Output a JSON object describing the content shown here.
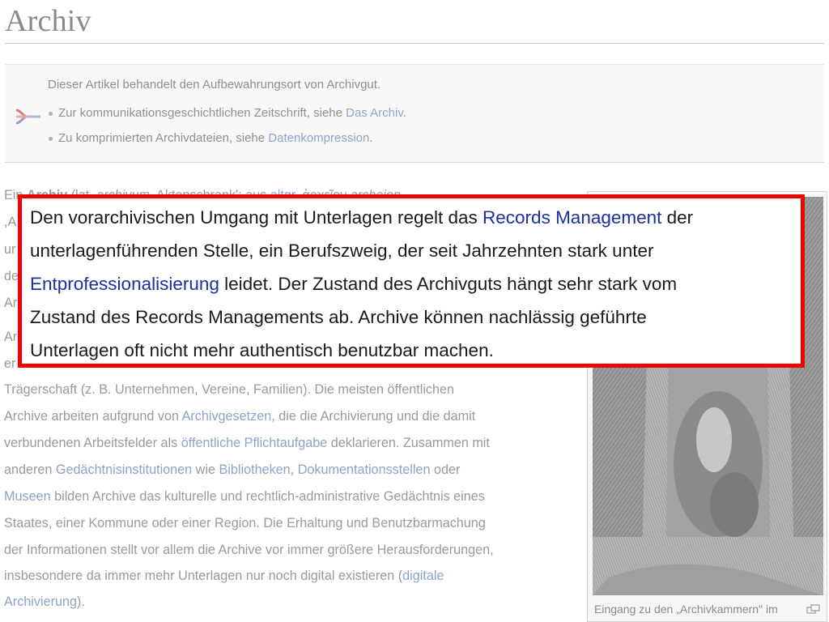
{
  "article": {
    "title": "Archiv"
  },
  "hatnote": {
    "intro": "Dieser Artikel behandelt den Aufbewahrungsort von Archivgut.",
    "items": [
      {
        "prefix": "Zur kommunikationsgeschichtlichen Zeitschrift, siehe ",
        "link": "Das Archiv",
        "suffix": "."
      },
      {
        "prefix": "Zu komprimierten Archivdateien, siehe ",
        "link": "Datenkompression",
        "suffix": "."
      }
    ]
  },
  "body": {
    "line1": {
      "t1": "Ein ",
      "bold": "Archiv",
      "t2": " (lat. ",
      "italic1": "archivum",
      "t3": " ‚Aktenschrank'; aus ",
      "link": "altgr.",
      "t4": " ἀρχεῖον ",
      "italic2": "archeion"
    },
    "line2": ",A",
    "line3": "ur",
    "line4": "de",
    "line5": "Ar",
    "line6": "Ar",
    "line7": "er",
    "line8": "Trägerschaft (z. B. Unternehmen, Vereine, Familien). Die meisten öffentlichen",
    "line9": {
      "t1": "Archive arbeiten aufgrund von ",
      "link": "Archivgesetzen",
      "t2": ", die die Archivierung und die damit"
    },
    "line10": {
      "t1": "verbundenen Arbeitsfelder als ",
      "link": "öffentliche Pflichtaufgabe",
      "t2": " deklarieren. Zusammen mit"
    },
    "line11": {
      "t1": "anderen ",
      "link1": "Gedächtnisinstitutionen",
      "t2": " wie ",
      "link2": "Bibliotheken",
      "t3": ", ",
      "link3": "Dokumentationsstellen",
      "t4": " oder"
    },
    "line12": {
      "link": "Museen",
      "t1": " bilden Archive das kulturelle und rechtlich-administrative Gedächtnis eines"
    },
    "line13": "Staates, einer Kommune oder einer Region. Die Erhaltung und Benutzbarmachung",
    "line14": "der Informationen stellt vor allem die Archive vor immer größere Herausforderungen,",
    "line15": {
      "t1": "insbesondere da immer mehr Unterlagen nur noch digital existieren (",
      "link": "digitale"
    },
    "line16": {
      "link": "Archivierung",
      "t1": ")."
    }
  },
  "thumb": {
    "caption": "Eingang zu den „Archivkammern\" im"
  },
  "callout": {
    "line1": {
      "t1": "Den vorarchivischen Umgang mit Unterlagen regelt das ",
      "link": "Records Management",
      "t2": " der"
    },
    "line2": "unterlagenführenden Stelle, ein Berufszweig, der seit Jahrzehnten stark unter",
    "line3": {
      "link": "Entprofessionalisierung",
      "t1": " leidet. Der Zustand des Archivguts hängt sehr stark vom"
    },
    "line4": "Zustand des Records Managements ab. Archive können nachlässig geführte",
    "line5": "Unterlagen oft nicht mehr authentisch benutzbar machen."
  },
  "colors": {
    "highlight_border": "#ee0000",
    "link": "#8ea3c9",
    "callout_link": "#1a2fa0"
  }
}
